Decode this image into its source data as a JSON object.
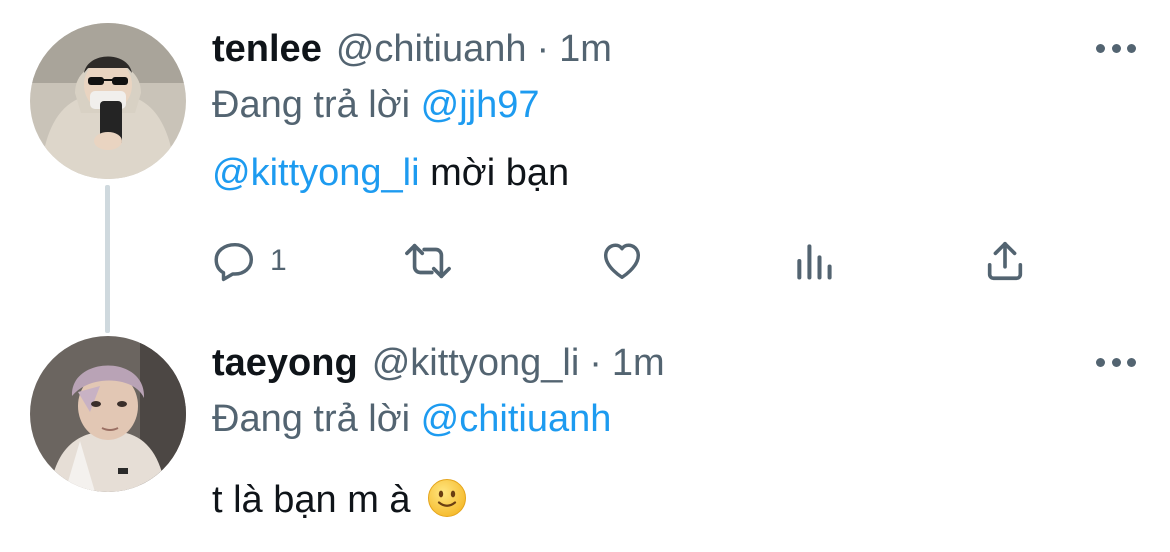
{
  "tweets": [
    {
      "name": "tenlee",
      "handle": "@chitiuanh",
      "separator": "·",
      "time": "1m",
      "reply_prefix": "Đang trả lời",
      "reply_to": "@jjh97",
      "body_mention": "@kittyong_li",
      "body_text": " mời bạn",
      "actions": {
        "reply_count": "1"
      }
    },
    {
      "name": "taeyong",
      "handle": "@kittyong_li",
      "separator": "·",
      "time": "1m",
      "reply_prefix": "Đang trả lời",
      "reply_to": "@chitiuanh",
      "body_text": "t là bạn m à",
      "body_emoji": "slightly-smiling-face"
    }
  ],
  "icons": {
    "reply": "reply-icon",
    "retweet": "retweet-icon",
    "like": "heart-icon",
    "stats": "analytics-icon",
    "share": "share-icon",
    "more": "more-icon"
  },
  "colors": {
    "text": "#0f1419",
    "muted": "#536471",
    "link": "#1d9bf0",
    "thread_line": "#cfd9de"
  }
}
